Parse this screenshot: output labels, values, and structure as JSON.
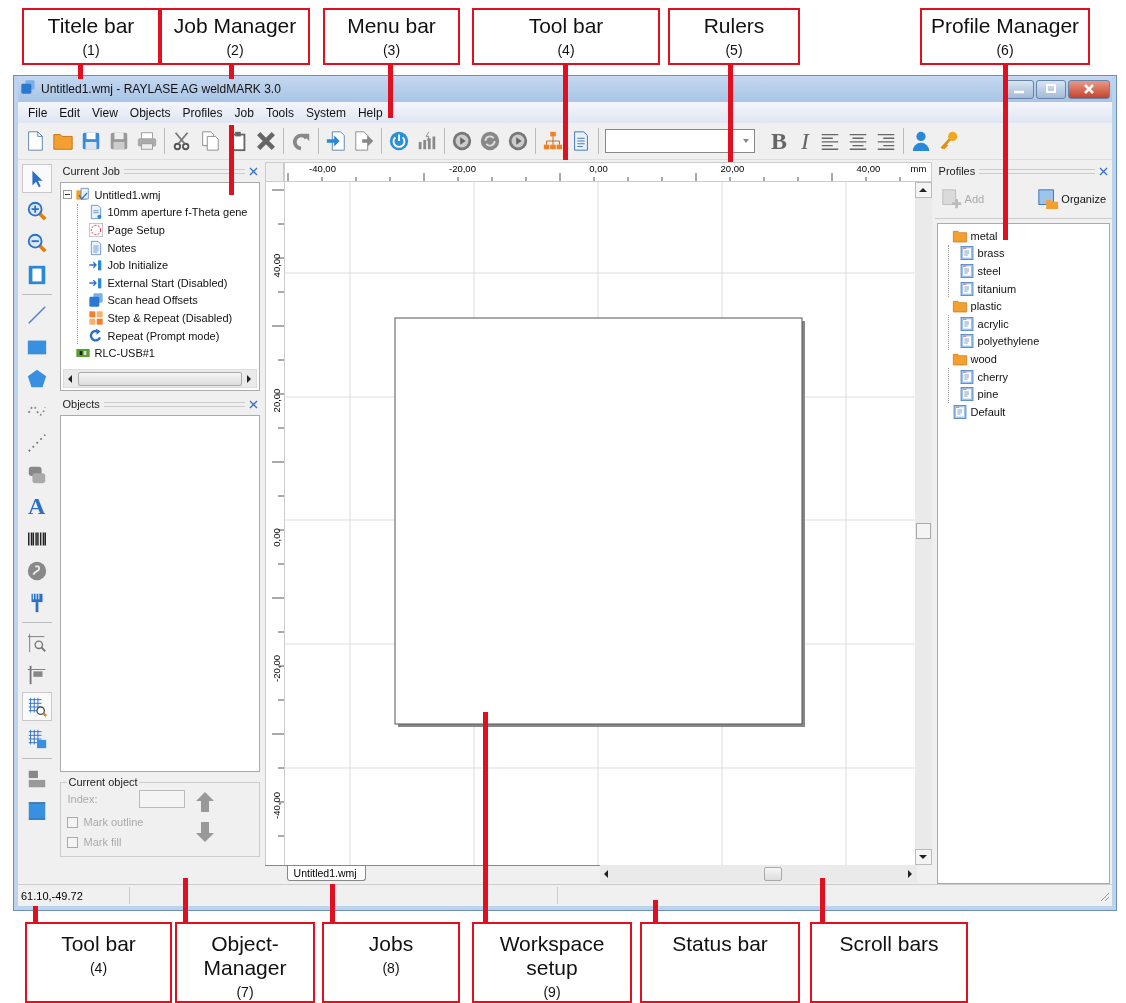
{
  "callouts_top": [
    {
      "title": "Titele bar",
      "number": "(1)"
    },
    {
      "title": "Job Manager",
      "number": "(2)"
    },
    {
      "title": "Menu bar",
      "number": "(3)"
    },
    {
      "title": "Tool bar",
      "number": "(4)"
    },
    {
      "title": "Rulers",
      "number": "(5)"
    },
    {
      "title": "Profile Manager",
      "number": "(6)"
    }
  ],
  "window": {
    "title": "Untitled1.wmj - RAYLASE AG weldMARK 3.0"
  },
  "menu": [
    "File",
    "Edit",
    "View",
    "Objects",
    "Profiles",
    "Job",
    "Tools",
    "System",
    "Help"
  ],
  "toolbar": [
    {
      "kind": "new"
    },
    {
      "kind": "open"
    },
    {
      "kind": "save"
    },
    {
      "kind": "save-grey"
    },
    {
      "kind": "print"
    },
    {
      "kind": "separator"
    },
    {
      "kind": "cut"
    },
    {
      "kind": "copy"
    },
    {
      "kind": "paste"
    },
    {
      "kind": "delete"
    },
    {
      "kind": "separator"
    },
    {
      "kind": "redo"
    },
    {
      "kind": "separator"
    },
    {
      "kind": "import"
    },
    {
      "kind": "export"
    },
    {
      "kind": "separator"
    },
    {
      "kind": "power"
    },
    {
      "kind": "bars"
    },
    {
      "kind": "separator"
    },
    {
      "kind": "play"
    },
    {
      "kind": "repeat"
    },
    {
      "kind": "play"
    },
    {
      "kind": "separator"
    },
    {
      "kind": "hierarchy"
    },
    {
      "kind": "notes"
    },
    {
      "kind": "separator"
    },
    {
      "kind": "combo"
    },
    {
      "kind": "bold",
      "label": "B"
    },
    {
      "kind": "italic",
      "label": "I"
    },
    {
      "kind": "align-left"
    },
    {
      "kind": "align-center"
    },
    {
      "kind": "align-right"
    },
    {
      "kind": "separator"
    },
    {
      "kind": "user"
    },
    {
      "kind": "key"
    }
  ],
  "tools": [
    {
      "kind": "pointer",
      "selected": true
    },
    {
      "kind": "zoom-in",
      "selected": false
    },
    {
      "kind": "zoom-out",
      "selected": false
    },
    {
      "kind": "page",
      "selected": false
    },
    {
      "kind": "separator"
    },
    {
      "kind": "line",
      "selected": false
    },
    {
      "kind": "rectangle",
      "selected": false
    },
    {
      "kind": "pentagon",
      "selected": false
    },
    {
      "kind": "dotted-curve",
      "selected": false
    },
    {
      "kind": "dotted-line",
      "selected": false
    },
    {
      "kind": "stack",
      "selected": false
    },
    {
      "kind": "letter",
      "label": "A",
      "selected": false
    },
    {
      "kind": "barcode",
      "selected": false
    },
    {
      "kind": "swirl",
      "selected": false
    },
    {
      "kind": "brush",
      "selected": false
    },
    {
      "kind": "separator"
    },
    {
      "kind": "frame-zoom",
      "selected": false
    },
    {
      "kind": "flag",
      "selected": false
    },
    {
      "kind": "grid-zoom",
      "selected": true
    },
    {
      "kind": "grid",
      "selected": false
    },
    {
      "kind": "separator"
    },
    {
      "kind": "bars-stack",
      "selected": false
    },
    {
      "kind": "frame",
      "selected": false
    }
  ],
  "current_job": {
    "title": "Current Job",
    "tree": [
      {
        "label": "Untitled1.wmj",
        "kind": "job",
        "expanded": true,
        "children": [
          {
            "label": "10mm aperture f-Theta gene",
            "kind": "document"
          },
          {
            "label": "Page Setup",
            "kind": "page-setup"
          },
          {
            "label": "Notes",
            "kind": "notes"
          },
          {
            "label": "Job Initialize",
            "kind": "arrow-in"
          },
          {
            "label": "External Start (Disabled)",
            "kind": "arrow-in"
          },
          {
            "label": "Scan head Offsets",
            "kind": "offsets"
          },
          {
            "label": "Step & Repeat (Disabled)",
            "kind": "tiles"
          },
          {
            "label": "Repeat (Prompt mode)",
            "kind": "repeat"
          }
        ]
      },
      {
        "label": "RLC-USB#1",
        "kind": "board"
      }
    ]
  },
  "objects": {
    "title": "Objects"
  },
  "current_object": {
    "title": "Current object",
    "index_label": "Index:",
    "disabled": true,
    "checkboxes": [
      {
        "label": "Mark outline",
        "checked": false
      },
      {
        "label": "Mark fill",
        "checked": false
      }
    ]
  },
  "rulers": {
    "horizontal": [
      "-40,00",
      "-20,00",
      "0,00",
      "20,00",
      "40,00"
    ],
    "unit": "mm",
    "vertical": [
      "40,00",
      "20,00",
      "0,00",
      "-20,00",
      "-40,00"
    ]
  },
  "jobs": [
    {
      "label": "Untitled1.wmj",
      "selected": true
    }
  ],
  "profiles": {
    "title": "Profiles",
    "buttons": [
      {
        "label": "Add",
        "kind": "add",
        "disabled": true
      },
      {
        "label": "Organize",
        "kind": "organize",
        "disabled": false
      }
    ],
    "tree": [
      {
        "label": "metal",
        "kind": "folder",
        "children": [
          {
            "label": "brass",
            "kind": "profile"
          },
          {
            "label": "steel",
            "kind": "profile"
          },
          {
            "label": "titanium",
            "kind": "profile"
          }
        ]
      },
      {
        "label": "plastic",
        "kind": "folder",
        "children": [
          {
            "label": "acrylic",
            "kind": "profile"
          },
          {
            "label": "polyethylene",
            "kind": "profile"
          }
        ]
      },
      {
        "label": "wood",
        "kind": "folder",
        "children": [
          {
            "label": "cherry",
            "kind": "profile"
          },
          {
            "label": "pine",
            "kind": "profile"
          }
        ]
      },
      {
        "label": "Default",
        "kind": "profile"
      }
    ]
  },
  "status_bar": {
    "coordinates": "61.10,-49.72"
  },
  "callouts_bottom": [
    {
      "title": "Tool bar",
      "number": "(4)"
    },
    {
      "title": "Object-Manager",
      "number": "(7)"
    },
    {
      "title": "Jobs",
      "number": "(8)"
    },
    {
      "title": "Workspace setup",
      "number": "(9)"
    },
    {
      "title": "Status bar"
    },
    {
      "title": "Scroll bars"
    }
  ]
}
